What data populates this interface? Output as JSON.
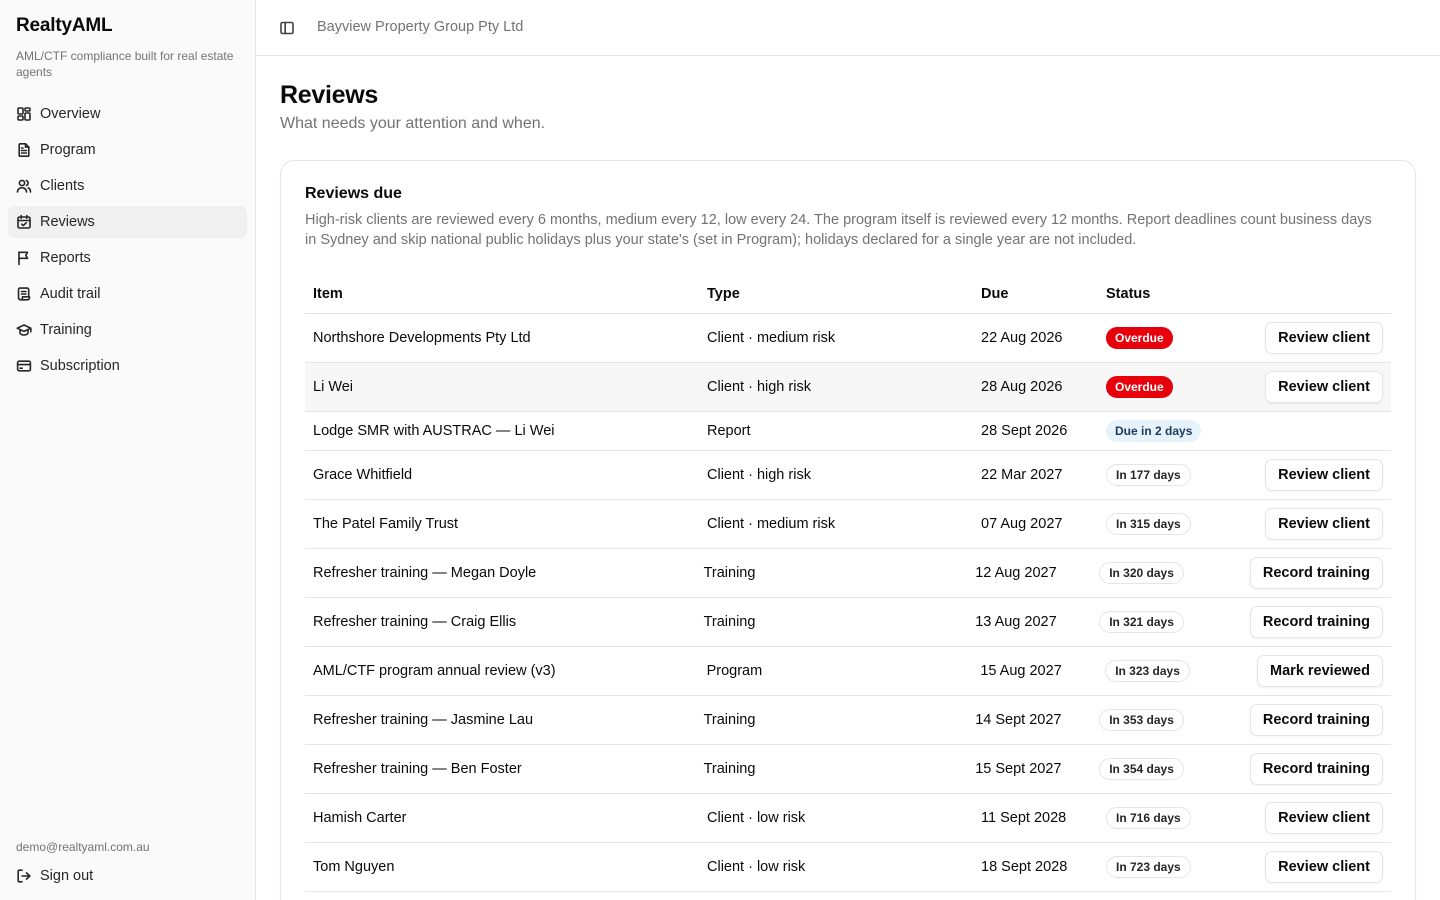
{
  "app": {
    "name": "RealtyAML",
    "tagline": "AML/CTF compliance built for real estate agents"
  },
  "sidebar": {
    "items": [
      {
        "label": "Overview",
        "icon": "layout-dashboard-icon"
      },
      {
        "label": "Program",
        "icon": "file-text-icon"
      },
      {
        "label": "Clients",
        "icon": "users-icon"
      },
      {
        "label": "Reviews",
        "icon": "calendar-check-icon",
        "active": true
      },
      {
        "label": "Reports",
        "icon": "flag-icon"
      },
      {
        "label": "Audit trail",
        "icon": "scroll-icon"
      },
      {
        "label": "Training",
        "icon": "graduation-cap-icon"
      },
      {
        "label": "Subscription",
        "icon": "credit-card-icon"
      }
    ],
    "user_email": "demo@realtyaml.com.au",
    "signout_label": "Sign out"
  },
  "header": {
    "org_name": "Bayview Property Group Pty Ltd"
  },
  "page": {
    "title": "Reviews",
    "subtitle": "What needs your attention and when."
  },
  "card": {
    "title": "Reviews due",
    "description": "High-risk clients are reviewed every 6 months, medium every 12, low every 24. The program itself is reviewed every 12 months. Report deadlines count business days in Sydney and skip national public holidays plus your state's (set in Program); holidays declared for a single year are not included."
  },
  "table": {
    "columns": [
      "Item",
      "Type",
      "Due",
      "Status"
    ],
    "rows": [
      {
        "item": "Northshore Developments Pty Ltd",
        "type": "Client · medium risk",
        "due": "22 Aug 2026",
        "status": "Overdue",
        "status_kind": "overdue",
        "action": "Review client"
      },
      {
        "item": "Li Wei",
        "type": "Client · high risk",
        "due": "28 Aug 2026",
        "status": "Overdue",
        "status_kind": "overdue",
        "action": "Review client",
        "highlight": true
      },
      {
        "item": "Lodge SMR with AUSTRAC — Li Wei",
        "type": "Report",
        "due": "28 Sept 2026",
        "status": "Due in 2 days",
        "status_kind": "soon",
        "action": ""
      },
      {
        "item": "Grace Whitfield",
        "type": "Client · high risk",
        "due": "22 Mar 2027",
        "status": "In 177 days",
        "status_kind": "later",
        "action": "Review client"
      },
      {
        "item": "The Patel Family Trust",
        "type": "Client · medium risk",
        "due": "07 Aug 2027",
        "status": "In 315 days",
        "status_kind": "later",
        "action": "Review client"
      },
      {
        "item": "Refresher training — Megan Doyle",
        "type": "Training",
        "due": "12 Aug 2027",
        "status": "In 320 days",
        "status_kind": "later",
        "action": "Record training"
      },
      {
        "item": "Refresher training — Craig Ellis",
        "type": "Training",
        "due": "13 Aug 2027",
        "status": "In 321 days",
        "status_kind": "later",
        "action": "Record training"
      },
      {
        "item": "AML/CTF program annual review (v3)",
        "type": "Program",
        "due": "15 Aug 2027",
        "status": "In 323 days",
        "status_kind": "later",
        "action": "Mark reviewed"
      },
      {
        "item": "Refresher training — Jasmine Lau",
        "type": "Training",
        "due": "14 Sept 2027",
        "status": "In 353 days",
        "status_kind": "later",
        "action": "Record training"
      },
      {
        "item": "Refresher training — Ben Foster",
        "type": "Training",
        "due": "15 Sept 2027",
        "status": "In 354 days",
        "status_kind": "later",
        "action": "Record training"
      },
      {
        "item": "Hamish Carter",
        "type": "Client · low risk",
        "due": "11 Sept 2028",
        "status": "In 716 days",
        "status_kind": "later",
        "action": "Review client"
      },
      {
        "item": "Tom Nguyen",
        "type": "Client · low risk",
        "due": "18 Sept 2028",
        "status": "In 723 days",
        "status_kind": "later",
        "action": "Review client"
      }
    ]
  },
  "colors": {
    "overdue_badge": "#e7000b",
    "soon_badge": "#e6f3fb",
    "active_nav_bg": "#f0f0f0",
    "border": "#e5e5e5",
    "muted_text": "#737373"
  }
}
